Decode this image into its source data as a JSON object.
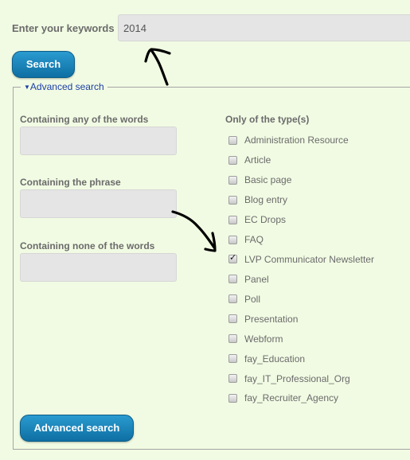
{
  "keywords": {
    "label": "Enter your keywords",
    "value": "2014"
  },
  "search_button": {
    "label": "Search"
  },
  "advanced": {
    "legend": "Advanced search",
    "toggle_icon": "triangle-down-icon",
    "fields": [
      {
        "label": "Containing any of the words",
        "value": ""
      },
      {
        "label": "Containing the phrase",
        "value": ""
      },
      {
        "label": "Containing none of the words",
        "value": ""
      }
    ],
    "types_label": "Only of the type(s)",
    "types": [
      {
        "label": "Administration Resource",
        "checked": false
      },
      {
        "label": "Article",
        "checked": false
      },
      {
        "label": "Basic page",
        "checked": false
      },
      {
        "label": "Blog entry",
        "checked": false
      },
      {
        "label": "EC Drops",
        "checked": false
      },
      {
        "label": "FAQ",
        "checked": false
      },
      {
        "label": "LVP Communicator Newsletter",
        "checked": true
      },
      {
        "label": "Panel",
        "checked": false
      },
      {
        "label": "Poll",
        "checked": false
      },
      {
        "label": "Presentation",
        "checked": false
      },
      {
        "label": "Webform",
        "checked": false
      },
      {
        "label": "fay_Education",
        "checked": false
      },
      {
        "label": "fay_IT_Professional_Org",
        "checked": false
      },
      {
        "label": "fay_Recruiter_Agency",
        "checked": false
      }
    ],
    "submit_label": "Advanced search"
  },
  "colors": {
    "background": "#f1fbe3",
    "button": "#1a84bb",
    "link": "#1b3ea6"
  }
}
